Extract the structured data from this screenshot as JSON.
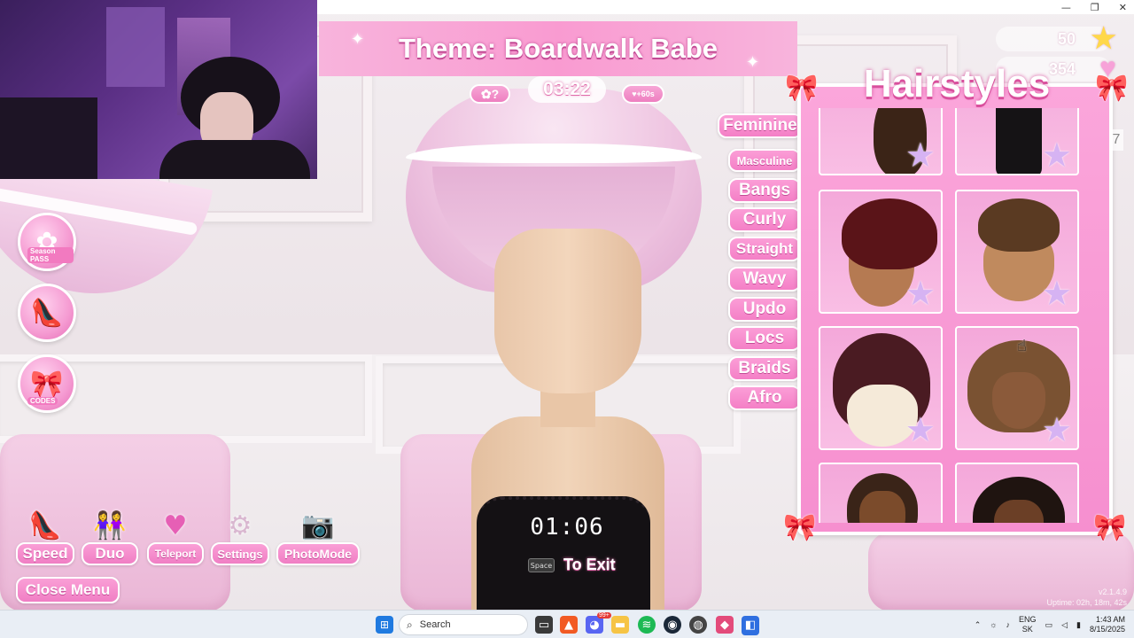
{
  "window": {
    "controls": {
      "minimize": "—",
      "restore": "❐",
      "close": "✕"
    }
  },
  "hud": {
    "theme_banner": "Theme: Boardwalk Babe",
    "round_timer": "03:22",
    "vip_pill": "+60s",
    "currency_1": {
      "value": "50",
      "icon": "star-icon"
    },
    "currency_2": {
      "value": "354",
      "icon": "heart-icon"
    },
    "scroll_number": "7"
  },
  "left_icons": [
    {
      "name": "season-pass-icon",
      "label": "Season PASS"
    },
    {
      "name": "shop-icon",
      "label": ""
    },
    {
      "name": "codes-icon",
      "label": "CODES"
    }
  ],
  "bottom_menu": [
    {
      "name": "speed",
      "label": "Speed",
      "icon": "heel-icon"
    },
    {
      "name": "duo",
      "label": "Duo",
      "icon": "duo-icon"
    },
    {
      "name": "teleport",
      "label": "Teleport",
      "icon": "teleport-icon"
    },
    {
      "name": "settings",
      "label": "Settings",
      "icon": "gear-icon"
    },
    {
      "name": "photomode",
      "label": "PhotoMode",
      "icon": "camera-icon"
    }
  ],
  "close_menu": "Close Menu",
  "exit_overlay": {
    "timer": "01:06",
    "key": "Space",
    "label": "To Exit"
  },
  "categories": [
    "Feminine",
    "Masculine",
    "Bangs",
    "Curly",
    "Straight",
    "Wavy",
    "Updo",
    "Locs",
    "Braids",
    "Afro"
  ],
  "panel": {
    "title": "Hairstyles",
    "tiles": [
      {
        "hair_color": "#3b2417",
        "skin": "",
        "style": "curly-partial"
      },
      {
        "hair_color": "#151315",
        "skin": "",
        "style": "braids-partial"
      },
      {
        "hair_color": "#5a1418",
        "skin": "#b57a52",
        "style": "short-curls"
      },
      {
        "hair_color": "#5a3a22",
        "skin": "#c08a5e",
        "style": "slick-back"
      },
      {
        "hair_color": "#4a1b22",
        "skin": "#f5ead9",
        "style": "bun-updo"
      },
      {
        "hair_color": "#7a5232",
        "skin": "#8b5a3a",
        "style": "afro-curls"
      },
      {
        "hair_color": "#3a2418",
        "skin": "#7b4b2b",
        "style": "locs-partial"
      },
      {
        "hair_color": "#1f1410",
        "skin": "#6b3f26",
        "style": "coily-partial"
      }
    ]
  },
  "overlay_text": {
    "version": "v2.1.4.9",
    "uptime": "Uptime: 02h, 18m, 42s"
  },
  "taskbar": {
    "search_placeholder": "Search",
    "time": "1:43 AM",
    "date": "8/15/2025",
    "lang_top": "ENG",
    "lang_bottom": "SK",
    "discord_badge": "99+"
  },
  "colors": {
    "accent_pink": "#f47fc6",
    "panel_pink": "#f68fcf",
    "text_white": "#ffffff"
  }
}
